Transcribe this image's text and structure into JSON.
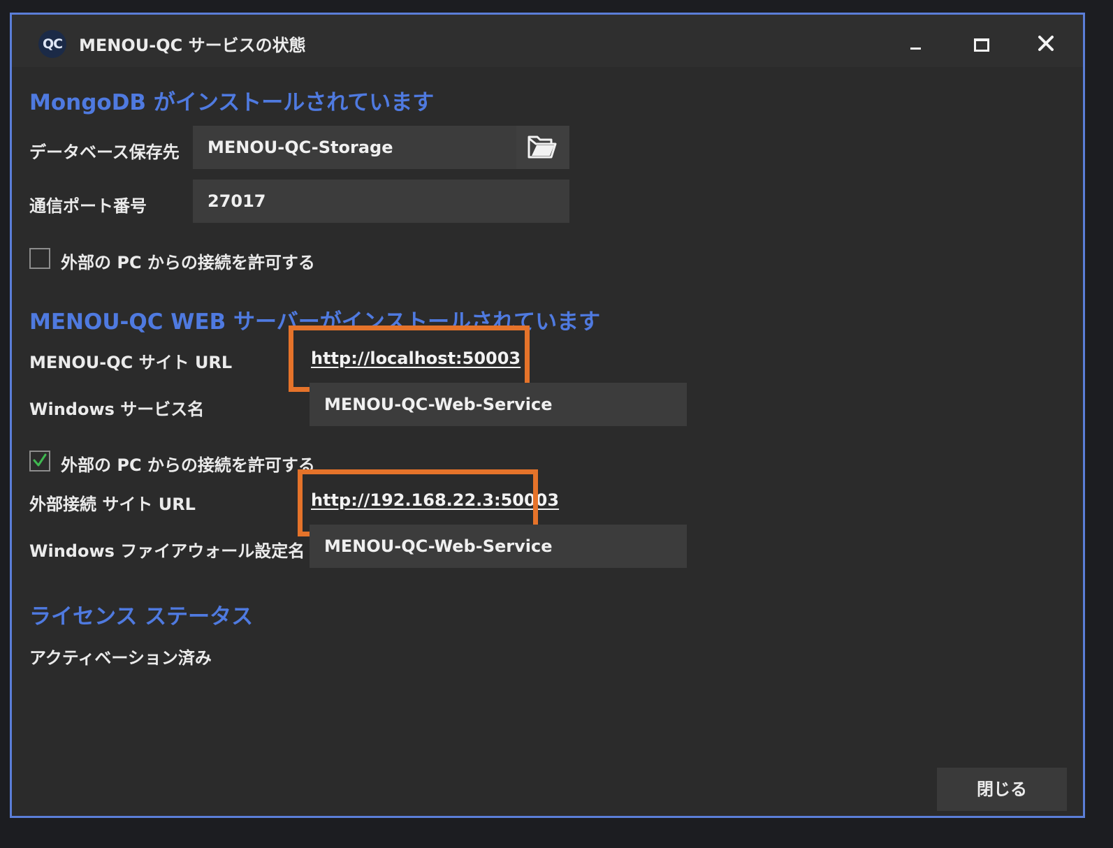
{
  "window": {
    "app_icon_text": "QC",
    "title": "MENOU-QC サービスの状態"
  },
  "mongodb": {
    "heading": "MongoDB がインストールされています",
    "db_location_label": "データベース保存先",
    "db_location_value": "MENOU-QC-Storage",
    "port_label": "通信ポート番号",
    "port_value": "27017",
    "allow_external_label": "外部の PC からの接続を許可する",
    "allow_external_checked": false
  },
  "web_server": {
    "heading": "MENOU-QC WEB サーバーがインストールされています",
    "site_url_label": "MENOU-QC サイト URL",
    "site_url": "http://localhost:50003",
    "service_name_label": "Windows サービス名",
    "service_name_value": "MENOU-QC-Web-Service",
    "allow_external_label": "外部の PC からの接続を許可する",
    "allow_external_checked": true,
    "external_url_label": "外部接続 サイト URL",
    "external_url": "http://192.168.22.3:50003",
    "firewall_label": "Windows ファイアウォール設定名",
    "firewall_value": "MENOU-QC-Web-Service"
  },
  "license": {
    "heading": "ライセンス ステータス",
    "status": "アクティベーション済み"
  },
  "footer": {
    "close_label": "閉じる"
  },
  "colors": {
    "accent": "#4f7ae0",
    "highlight": "#e5732a",
    "check": "#3fb950"
  },
  "icons": {
    "browse": "folder-open-icon",
    "minimize": "minimize-icon",
    "maximize": "maximize-icon",
    "close": "close-icon"
  }
}
